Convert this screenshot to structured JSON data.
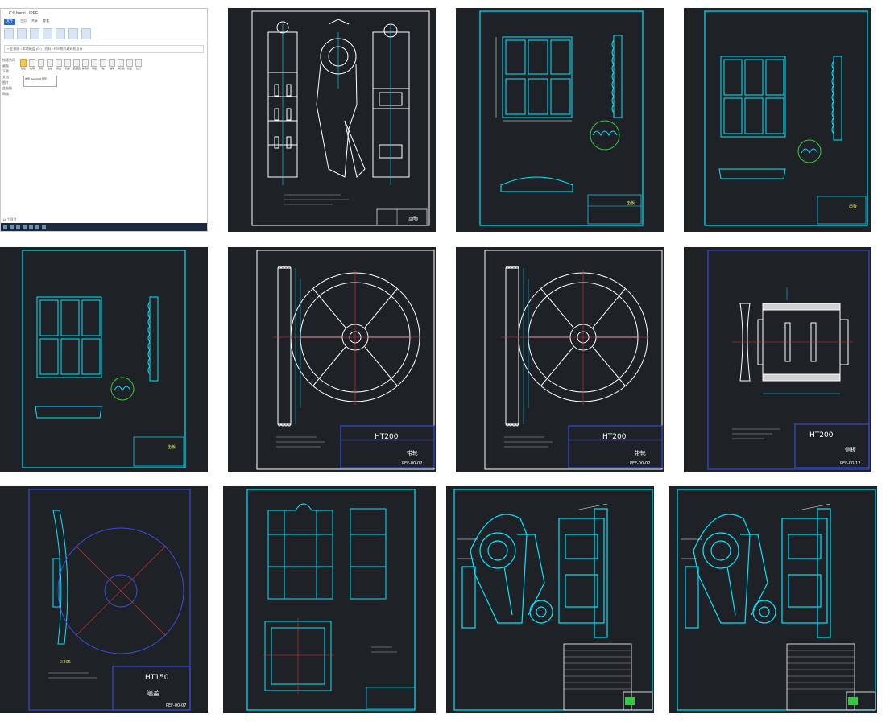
{
  "explorer": {
    "title": "C:\\Users\\...\\PEF",
    "tabs": [
      "文件",
      "主页",
      "共享",
      "查看"
    ],
    "address": "« 此电脑 › 本地磁盘 (D:) › 资料 › PEF颚式破碎机设计",
    "nav_items": [
      "快速访问",
      "桌面",
      "下载",
      "文档",
      "图片",
      "此电脑",
      "网络"
    ],
    "files": [
      "颚板",
      "动颚",
      "带轮",
      "齿板",
      "端盖",
      "机架",
      "装配图",
      "说明书",
      "侧板",
      "轴",
      "轴承",
      "偏心轴",
      "肘板",
      "拉杆"
    ],
    "status": "14 个项目",
    "tooltip": "类型: AutoCAD 图形"
  },
  "tiles": [
    {
      "name": "file-explorer-thumb"
    },
    {
      "name": "drawing-movable-jaw",
      "title_block": "动颚"
    },
    {
      "name": "drawing-jaw-plate-1",
      "title_block": "齿板"
    },
    {
      "name": "drawing-jaw-plate-2",
      "title_block": "齿板"
    },
    {
      "name": "drawing-jaw-plate-3",
      "title_block": "齿板"
    },
    {
      "name": "drawing-pulley-1",
      "material": "HT200",
      "part": "带轮",
      "code": "PEF-00-02"
    },
    {
      "name": "drawing-pulley-2",
      "material": "HT200",
      "part": "带轮",
      "code": "PEF-00-02"
    },
    {
      "name": "drawing-side-plate",
      "material": "HT200",
      "part": "侧板",
      "code": "PEF-00-12"
    },
    {
      "name": "drawing-end-cover",
      "material": "HT150",
      "part": "端盖",
      "code": "PEF-00-07"
    },
    {
      "name": "drawing-frame"
    },
    {
      "name": "drawing-assembly-1"
    },
    {
      "name": "drawing-assembly-2"
    }
  ],
  "colors": {
    "background": "#1e2227",
    "cyan": "#00e5ff",
    "white": "#ffffff",
    "blue": "#3a4bd8",
    "red": "#e03030",
    "yellow": "#e8e84a",
    "green": "#35c940"
  }
}
